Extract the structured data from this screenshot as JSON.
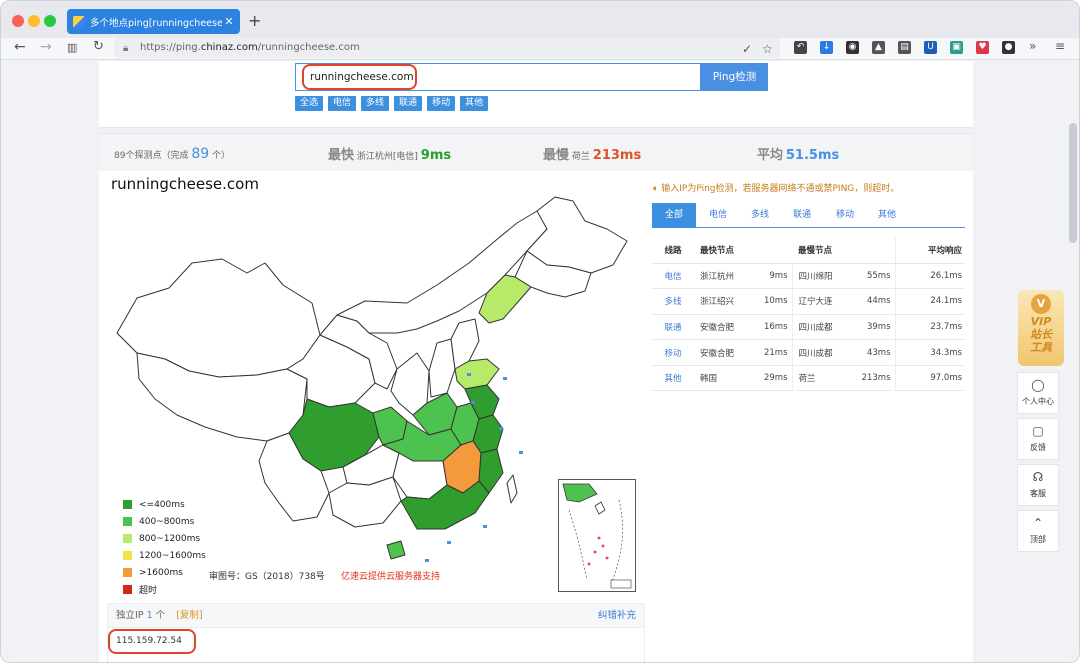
{
  "browser": {
    "tab_title": "多个地点ping[runningcheese.com",
    "tab_close": "✕",
    "new_tab": "+",
    "url_prefix": "https://ping.",
    "url_host": "chinaz.com",
    "url_path": "/runningcheese.com"
  },
  "search": {
    "input_value": "runningcheese.com",
    "button": "Ping检测",
    "filters": [
      "全选",
      "电信",
      "多线",
      "联通",
      "移动",
      "其他"
    ]
  },
  "stats": {
    "probe_prefix": "89个探测点（完成",
    "probe_done": "89",
    "probe_suffix": "个）",
    "fastest_label": "最快",
    "fastest_node": "浙江杭州[电信]",
    "fastest_value": "9ms",
    "slowest_label": "最慢",
    "slowest_node": "荷兰",
    "slowest_value": "213ms",
    "avg_label": "平均",
    "avg_value": "51.5ms"
  },
  "map": {
    "domain": "runningcheese.com",
    "legend": [
      {
        "label": "<=400ms",
        "color": "#2f9e2f"
      },
      {
        "label": "400~800ms",
        "color": "#4ec24e"
      },
      {
        "label": "800~1200ms",
        "color": "#b8ea6a"
      },
      {
        "label": "1200~1600ms",
        "color": "#f0e44a"
      },
      {
        "label": ">1600ms",
        "color": "#f29a3c"
      },
      {
        "label": "超时",
        "color": "#d8261a"
      }
    ],
    "approval_no": "审图号：GS（2018）738号",
    "provider_note": "亿速云提供云服务器支持"
  },
  "results": {
    "notice": "输入IP为Ping检测，若服务器网络不通或禁PING，则超时。",
    "tabs": [
      "全部",
      "电信",
      "多线",
      "联通",
      "移动",
      "其他"
    ],
    "headers": [
      "线路",
      "最快节点",
      "最慢节点",
      "平均响应"
    ],
    "rows": [
      {
        "line": "电信",
        "fast_node": "浙江杭州",
        "fast_ms": "9ms",
        "slow_node": "四川绵阳",
        "slow_ms": "55ms",
        "avg": "26.1ms"
      },
      {
        "line": "多线",
        "fast_node": "浙江绍兴",
        "fast_ms": "10ms",
        "slow_node": "辽宁大连",
        "slow_ms": "44ms",
        "avg": "24.1ms"
      },
      {
        "line": "联通",
        "fast_node": "安徽合肥",
        "fast_ms": "16ms",
        "slow_node": "四川成都",
        "slow_ms": "39ms",
        "avg": "23.7ms"
      },
      {
        "line": "移动",
        "fast_node": "安徽合肥",
        "fast_ms": "21ms",
        "slow_node": "四川成都",
        "slow_ms": "43ms",
        "avg": "34.3ms"
      },
      {
        "line": "其他",
        "fast_node": "韩国",
        "fast_ms": "29ms",
        "slow_node": "荷兰",
        "slow_ms": "213ms",
        "avg": "97.0ms"
      }
    ]
  },
  "ip": {
    "label": "独立IP",
    "count": "1",
    "count_unit": "个",
    "copy": "[复制]",
    "correct": "纠错补充",
    "value": "115.159.72.54"
  },
  "side": {
    "vip_badge": "V",
    "vip_line1": "VIP",
    "vip_line2": "站长",
    "vip_line3": "工具",
    "buttons": [
      {
        "label": "个人中心",
        "icon": "user-icon"
      },
      {
        "label": "反馈",
        "icon": "feedback-icon"
      },
      {
        "label": "客服",
        "icon": "headset-icon"
      },
      {
        "label": "顶部",
        "icon": "top-icon"
      }
    ]
  }
}
